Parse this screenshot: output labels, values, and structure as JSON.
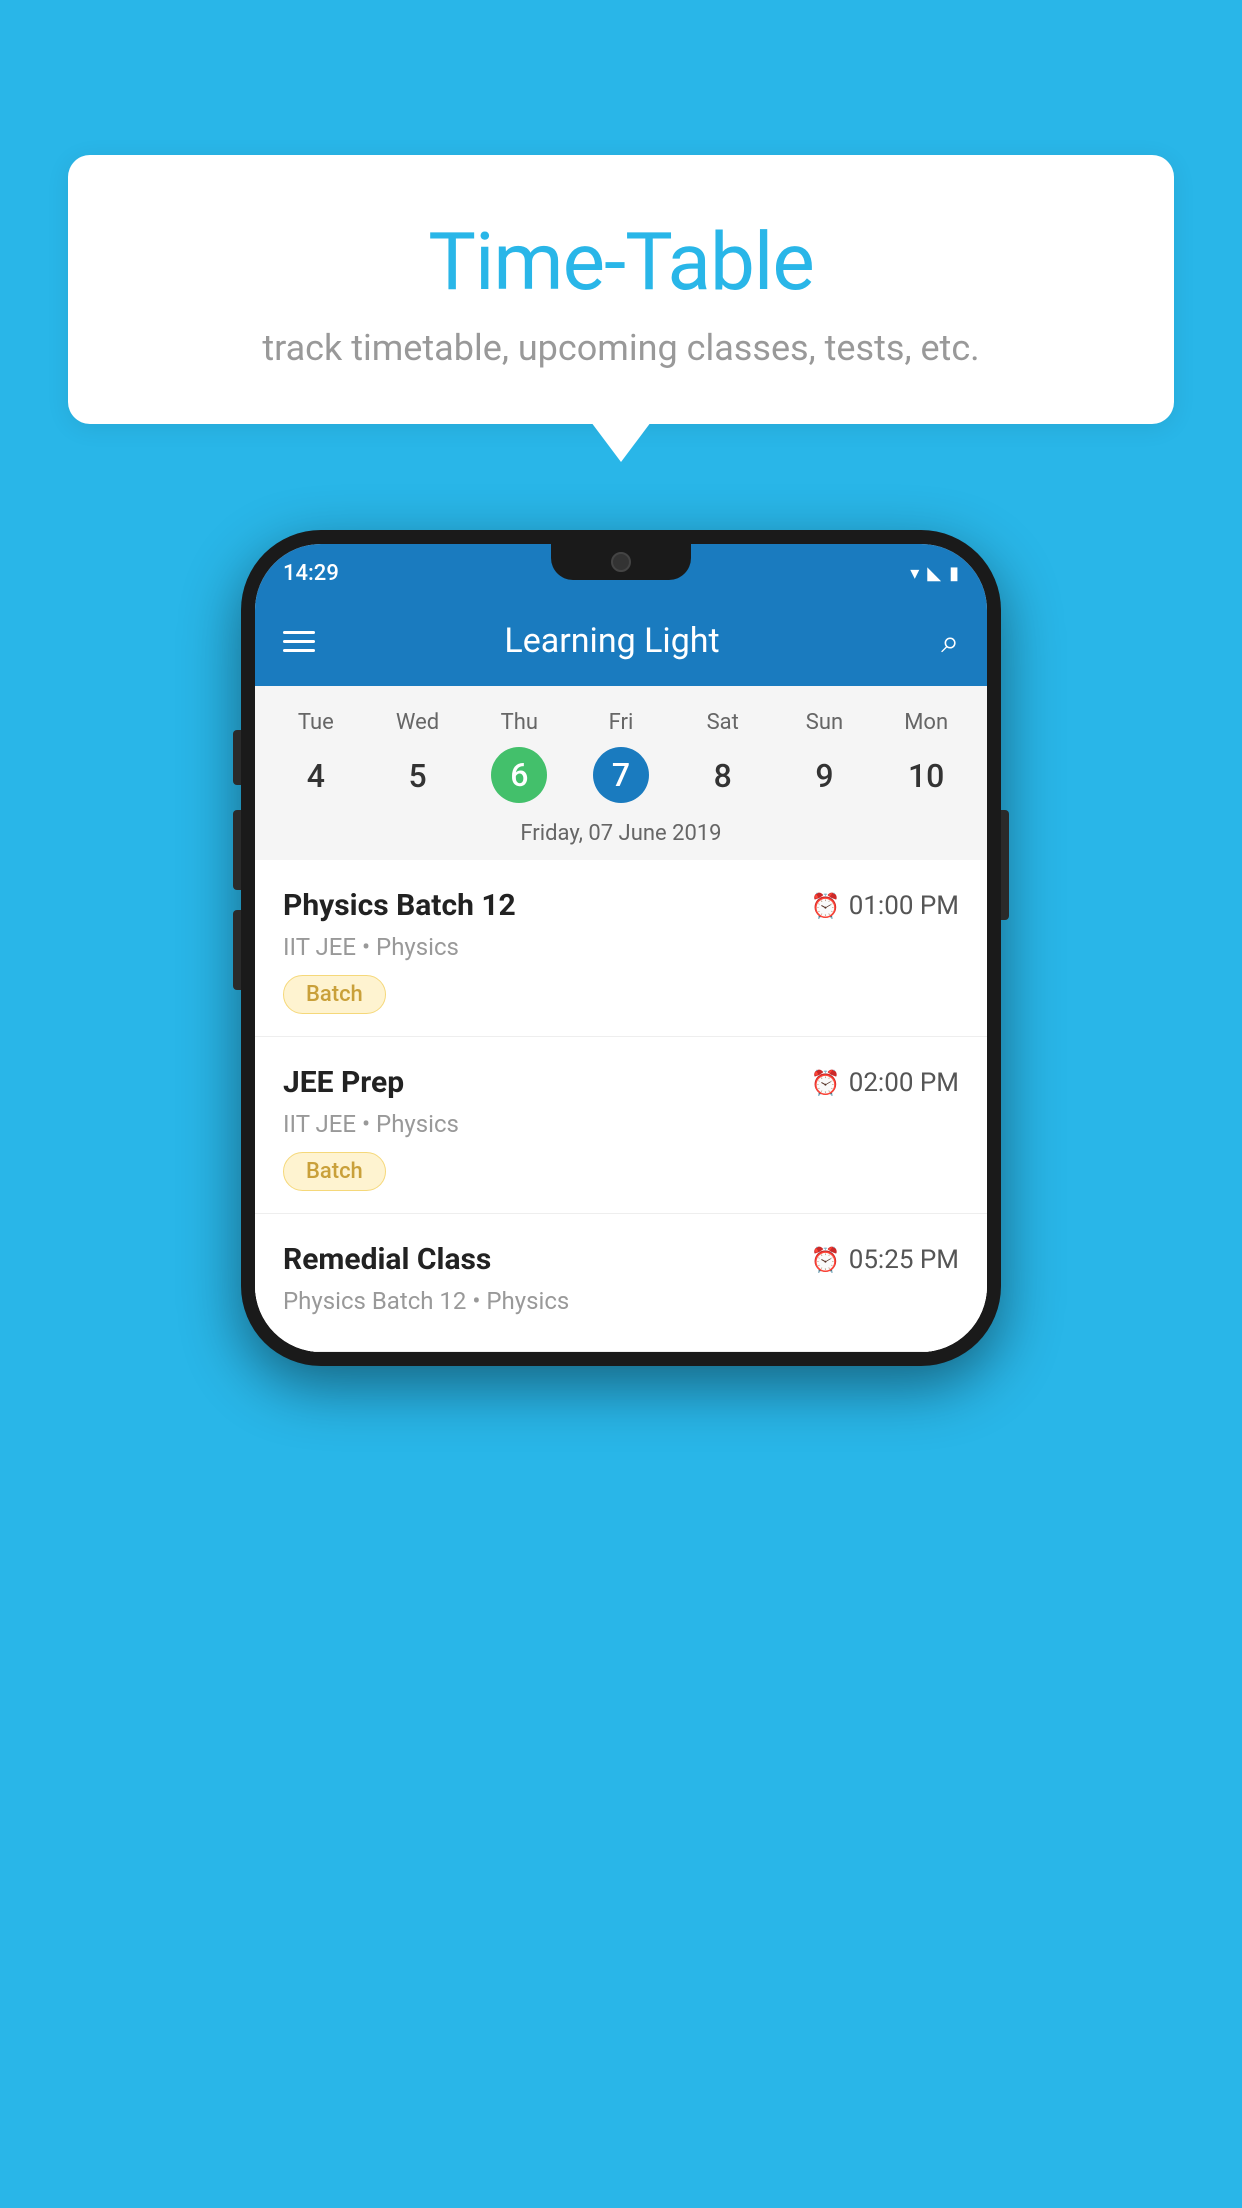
{
  "background_color": "#29b6e8",
  "bubble": {
    "title": "Time-Table",
    "subtitle": "track timetable, upcoming classes, tests, etc."
  },
  "status_bar": {
    "time": "14:29"
  },
  "app_bar": {
    "title": "Learning Light"
  },
  "calendar": {
    "days": [
      {
        "label": "Tue",
        "num": "4",
        "state": "normal"
      },
      {
        "label": "Wed",
        "num": "5",
        "state": "normal"
      },
      {
        "label": "Thu",
        "num": "6",
        "state": "today"
      },
      {
        "label": "Fri",
        "num": "7",
        "state": "selected"
      },
      {
        "label": "Sat",
        "num": "8",
        "state": "normal"
      },
      {
        "label": "Sun",
        "num": "9",
        "state": "normal"
      },
      {
        "label": "Mon",
        "num": "10",
        "state": "normal"
      }
    ],
    "date_label": "Friday, 07 June 2019"
  },
  "classes": [
    {
      "name": "Physics Batch 12",
      "time": "01:00 PM",
      "meta": "IIT JEE • Physics",
      "tag": "Batch"
    },
    {
      "name": "JEE Prep",
      "time": "02:00 PM",
      "meta": "IIT JEE • Physics",
      "tag": "Batch"
    },
    {
      "name": "Remedial Class",
      "time": "05:25 PM",
      "meta": "Physics Batch 12 • Physics",
      "tag": ""
    }
  ]
}
